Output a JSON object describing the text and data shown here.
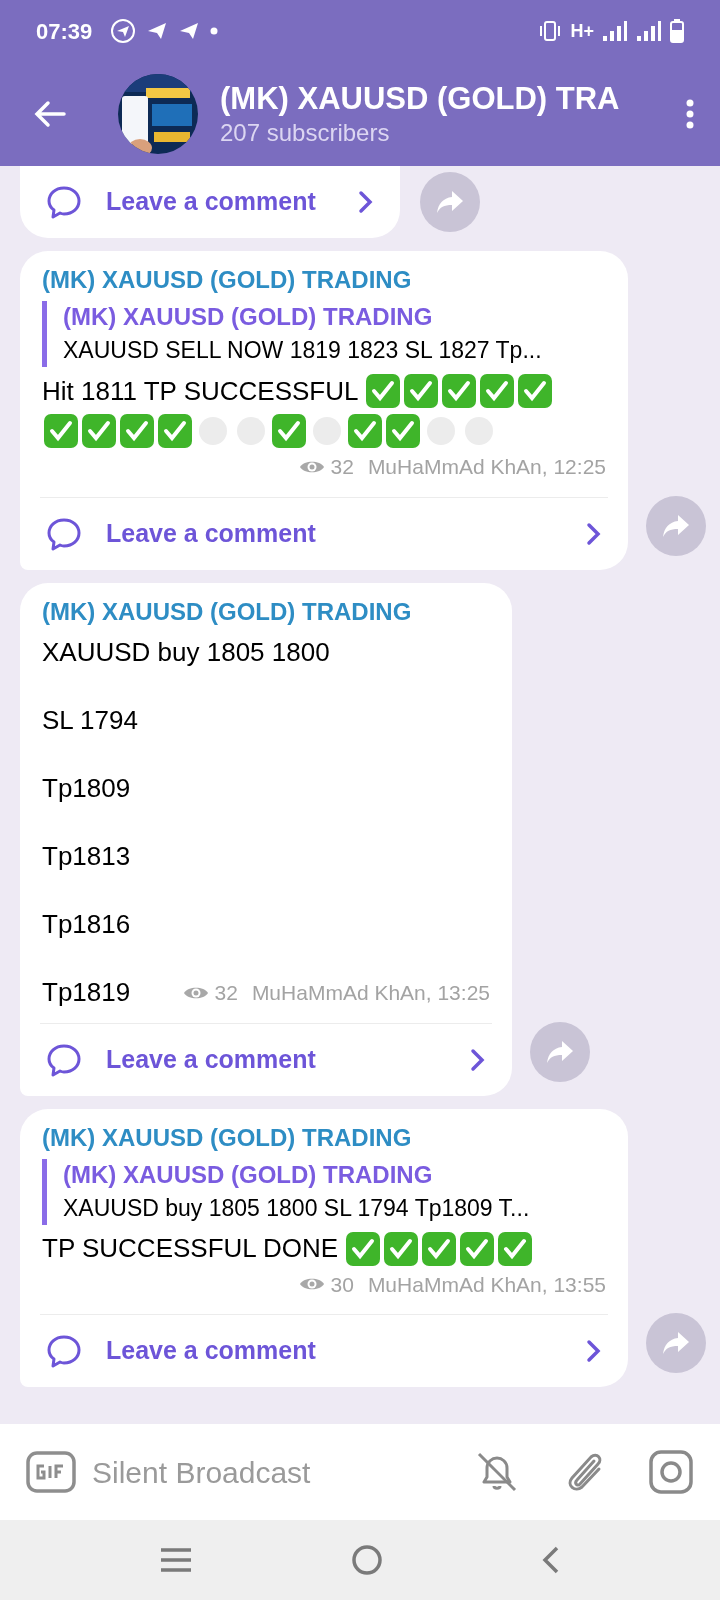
{
  "status_bar": {
    "time": "07:39",
    "network": "H+"
  },
  "header": {
    "title": "(MK) XAUUSD (GOLD) TRA",
    "subtitle": "207 subscribers"
  },
  "messages": [
    {
      "kind": "partial",
      "comment_label": "Leave a comment"
    },
    {
      "kind": "post",
      "channel": "(MK) XAUUSD (GOLD) TRADING",
      "forward": {
        "from": "(MK) XAUUSD (GOLD) TRADING",
        "text": "XAUUSD SELL NOW 1819 1823  SL 1827  Tp..."
      },
      "lines": [
        "Hit 1811 TP SUCCESSFUL"
      ],
      "marks": [
        [
          {
            "kind": "check"
          },
          {
            "kind": "check"
          },
          {
            "kind": "check"
          },
          {
            "kind": "check"
          },
          {
            "kind": "check"
          }
        ],
        [
          {
            "kind": "check"
          },
          {
            "kind": "check"
          },
          {
            "kind": "check"
          },
          {
            "kind": "check"
          },
          {
            "kind": "blank"
          },
          {
            "kind": "blank"
          },
          {
            "kind": "check"
          },
          {
            "kind": "blank"
          },
          {
            "kind": "check"
          },
          {
            "kind": "check"
          },
          {
            "kind": "blank"
          },
          {
            "kind": "blank"
          }
        ]
      ],
      "views": "32",
      "signature": "MuHaMmAd KhAn, 12:25",
      "comment_label": "Leave a comment"
    },
    {
      "kind": "post",
      "channel": "(MK) XAUUSD (GOLD) TRADING",
      "lines": [
        "XAUUSD buy 1805 1800",
        "SL 1794",
        "Tp1809",
        "Tp1813",
        "Tp1816",
        "Tp1819"
      ],
      "views": "32",
      "signature": "MuHaMmAd KhAn, 13:25",
      "comment_label": "Leave a comment"
    },
    {
      "kind": "post",
      "channel": "(MK) XAUUSD (GOLD) TRADING",
      "forward": {
        "from": "(MK) XAUUSD (GOLD) TRADING",
        "text": "XAUUSD buy 1805 1800  SL 1794  Tp1809  T..."
      },
      "lines": [
        "TP SUCCESSFUL DONE"
      ],
      "marks": [
        [
          {
            "kind": "check"
          },
          {
            "kind": "check"
          },
          {
            "kind": "check"
          },
          {
            "kind": "check"
          },
          {
            "kind": "check"
          }
        ]
      ],
      "views": "30",
      "signature": "MuHaMmAd KhAn, 13:55",
      "comment_label": "Leave a comment"
    }
  ],
  "composer": {
    "placeholder": "Silent Broadcast"
  }
}
